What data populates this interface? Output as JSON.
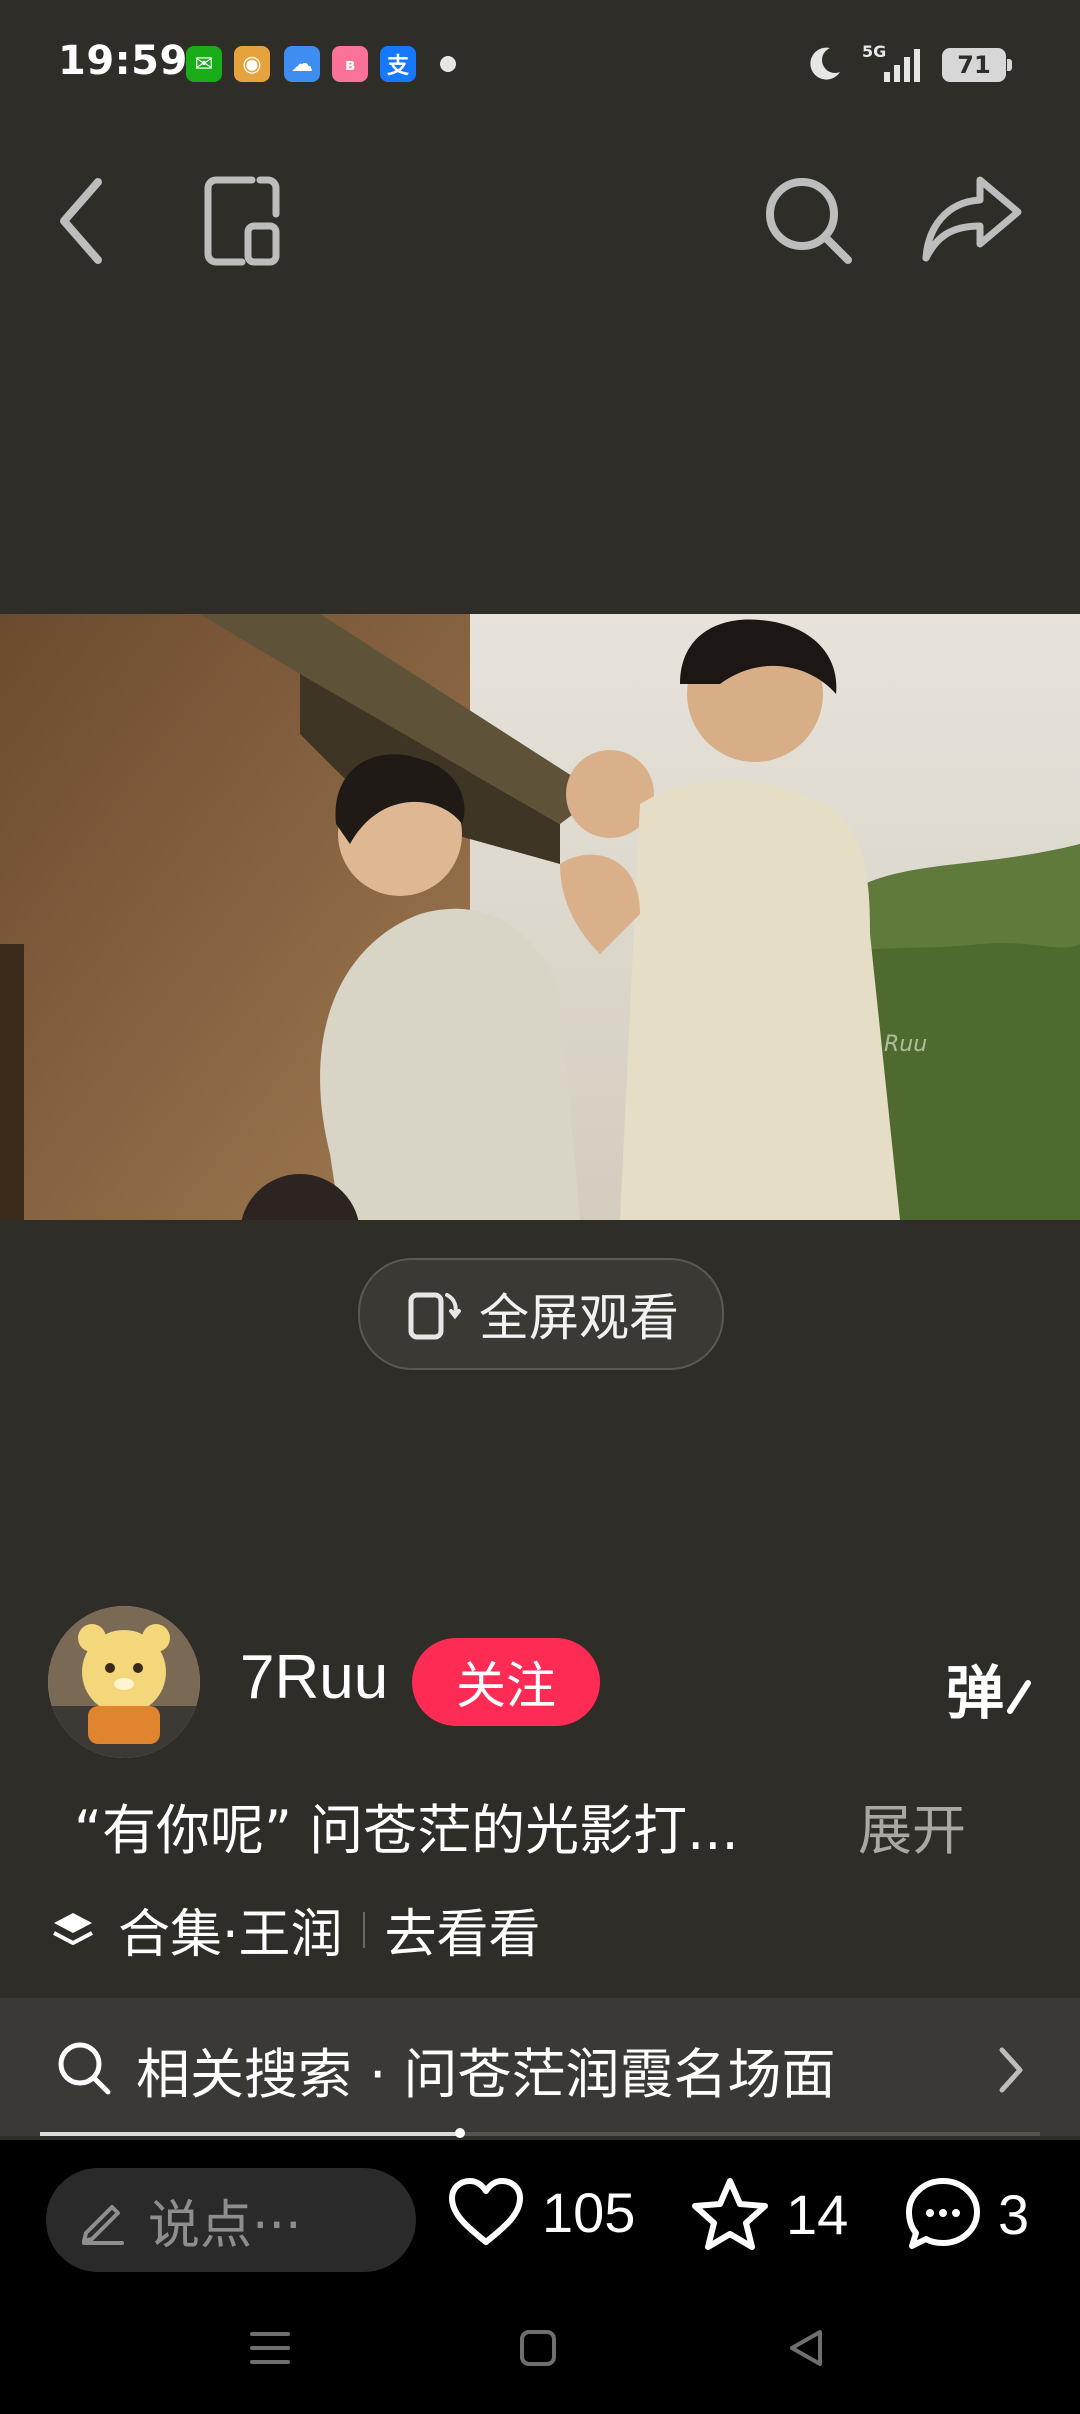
{
  "status_bar": {
    "time": "19:59",
    "apps": [
      {
        "icon": "wechat-icon",
        "color": "#1aad19",
        "glyph": "✉"
      },
      {
        "icon": "weibo-icon",
        "color": "#e6a23c",
        "glyph": "◉"
      },
      {
        "icon": "weather-icon",
        "color": "#3d8ef0",
        "glyph": "☁"
      },
      {
        "icon": "bilibili-icon",
        "color": "#fb7299",
        "glyph": "ʙ"
      },
      {
        "icon": "alipay-icon",
        "color": "#1677ff",
        "glyph": "支"
      }
    ],
    "network": "5G",
    "battery": "71"
  },
  "video": {
    "watermark": "Ruu",
    "fullscreen_label": "全屏观看"
  },
  "author": {
    "name": "7Ruu",
    "follow_label": "关注",
    "danmaku_label": "弹"
  },
  "description": {
    "text": "“有你呢” 问苍茫的光影打...",
    "expand_label": "展开"
  },
  "collection": {
    "label": "合集·王润",
    "action": "去看看"
  },
  "related_search": {
    "text": "相关搜索 · 问苍茫润霞名场面"
  },
  "progress": {
    "played_fraction": 0.42
  },
  "bottom": {
    "comment_placeholder": "说点···",
    "likes": "105",
    "favorites": "14",
    "comments": "3"
  },
  "colors": {
    "background": "#2e2d28",
    "follow": "#fe2c55",
    "bottom_bar": "#000000"
  }
}
